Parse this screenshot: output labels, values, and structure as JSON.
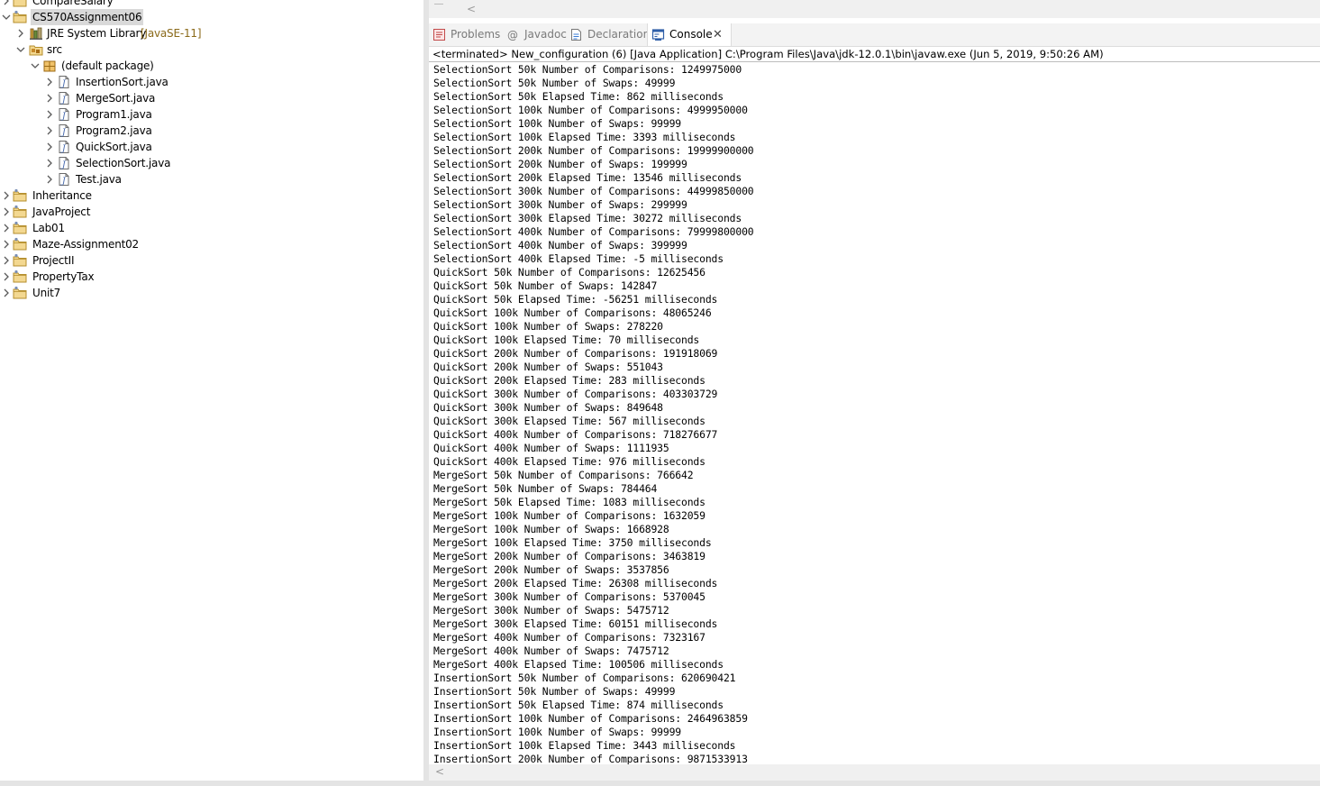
{
  "explorer": {
    "items": [
      {
        "label": "CompareSalary",
        "icon": "project-icon",
        "expanded": false,
        "depth": 0
      },
      {
        "label": "CS570Assignment06",
        "icon": "project-icon",
        "expanded": true,
        "depth": 0,
        "selected": true
      },
      {
        "label": "JRE System Library",
        "decoration": "[JavaSE-11]",
        "icon": "library-icon",
        "expanded": false,
        "depth": 1
      },
      {
        "label": "src",
        "icon": "source-folder-icon",
        "expanded": true,
        "depth": 1
      },
      {
        "label": "(default package)",
        "icon": "package-icon",
        "expanded": true,
        "depth": 2
      },
      {
        "label": "InsertionSort.java",
        "icon": "java-file-icon",
        "expanded": false,
        "depth": 3
      },
      {
        "label": "MergeSort.java",
        "icon": "java-file-icon",
        "expanded": false,
        "depth": 3
      },
      {
        "label": "Program1.java",
        "icon": "java-file-icon",
        "expanded": false,
        "depth": 3
      },
      {
        "label": "Program2.java",
        "icon": "java-file-icon",
        "expanded": false,
        "depth": 3
      },
      {
        "label": "QuickSort.java",
        "icon": "java-file-icon",
        "expanded": false,
        "depth": 3
      },
      {
        "label": "SelectionSort.java",
        "icon": "java-file-icon",
        "expanded": false,
        "depth": 3
      },
      {
        "label": "Test.java",
        "icon": "java-file-icon",
        "expanded": false,
        "depth": 3
      },
      {
        "label": "Inheritance",
        "icon": "project-icon",
        "expanded": false,
        "depth": 0
      },
      {
        "label": "JavaProject",
        "icon": "project-icon",
        "expanded": false,
        "depth": 0
      },
      {
        "label": "Lab01",
        "icon": "project-icon",
        "expanded": false,
        "depth": 0
      },
      {
        "label": "Maze-Assignment02",
        "icon": "project-icon",
        "expanded": false,
        "depth": 0
      },
      {
        "label": "ProjectII",
        "icon": "project-icon",
        "expanded": false,
        "depth": 0
      },
      {
        "label": "PropertyTax",
        "icon": "project-icon",
        "expanded": false,
        "depth": 0
      },
      {
        "label": "Unit7",
        "icon": "project-icon",
        "expanded": false,
        "depth": 0
      }
    ]
  },
  "tabs": [
    {
      "label": "Problems",
      "icon": "problems-icon",
      "active": false
    },
    {
      "label": "Javadoc",
      "icon": "javadoc-icon",
      "active": false
    },
    {
      "label": "Declaration",
      "icon": "declaration-icon",
      "active": false
    },
    {
      "label": "Console",
      "icon": "console-icon",
      "active": true,
      "close": "✕"
    }
  ],
  "console": {
    "header": "<terminated> New_configuration (6) [Java Application] C:\\Program Files\\Java\\jdk-12.0.1\\bin\\javaw.exe (Jun 5, 2019, 9:50:26 AM)",
    "lines": [
      "SelectionSort 50k Number of Comparisons: 1249975000",
      "SelectionSort 50k Number of Swaps: 49999",
      "SelectionSort 50k Elapsed Time: 862 milliseconds",
      "SelectionSort 100k Number of Comparisons: 4999950000",
      "SelectionSort 100k Number of Swaps: 99999",
      "SelectionSort 100k Elapsed Time: 3393 milliseconds",
      "SelectionSort 200k Number of Comparisons: 19999900000",
      "SelectionSort 200k Number of Swaps: 199999",
      "SelectionSort 200k Elapsed Time: 13546 milliseconds",
      "SelectionSort 300k Number of Comparisons: 44999850000",
      "SelectionSort 300k Number of Swaps: 299999",
      "SelectionSort 300k Elapsed Time: 30272 milliseconds",
      "SelectionSort 400k Number of Comparisons: 79999800000",
      "SelectionSort 400k Number of Swaps: 399999",
      "SelectionSort 400k Elapsed Time: -5 milliseconds",
      "QuickSort 50k Number of Comparisons: 12625456",
      "QuickSort 50k Number of Swaps: 142847",
      "QuickSort 50k Elapsed Time: -56251 milliseconds",
      "QuickSort 100k Number of Comparisons: 48065246",
      "QuickSort 100k Number of Swaps: 278220",
      "QuickSort 100k Elapsed Time: 70 milliseconds",
      "QuickSort 200k Number of Comparisons: 191918069",
      "QuickSort 200k Number of Swaps: 551043",
      "QuickSort 200k Elapsed Time: 283 milliseconds",
      "QuickSort 300k Number of Comparisons: 403303729",
      "QuickSort 300k Number of Swaps: 849648",
      "QuickSort 300k Elapsed Time: 567 milliseconds",
      "QuickSort 400k Number of Comparisons: 718276677",
      "QuickSort 400k Number of Swaps: 1111935",
      "QuickSort 400k Elapsed Time: 976 milliseconds",
      "MergeSort 50k Number of Comparisons: 766642",
      "MergeSort 50k Number of Swaps: 784464",
      "MergeSort 50k Elapsed Time: 1083 milliseconds",
      "MergeSort 100k Number of Comparisons: 1632059",
      "MergeSort 100k Number of Swaps: 1668928",
      "MergeSort 100k Elapsed Time: 3750 milliseconds",
      "MergeSort 200k Number of Comparisons: 3463819",
      "MergeSort 200k Number of Swaps: 3537856",
      "MergeSort 200k Elapsed Time: 26308 milliseconds",
      "MergeSort 300k Number of Comparisons: 5370045",
      "MergeSort 300k Number of Swaps: 5475712",
      "MergeSort 300k Elapsed Time: 60151 milliseconds",
      "MergeSort 400k Number of Comparisons: 7323167",
      "MergeSort 400k Number of Swaps: 7475712",
      "MergeSort 400k Elapsed Time: 100506 milliseconds",
      "InsertionSort 50k Number of Comparisons: 620690421",
      "InsertionSort 50k Number of Swaps: 49999",
      "InsertionSort 50k Elapsed Time: 874 milliseconds",
      "InsertionSort 100k Number of Comparisons: 2464963859",
      "InsertionSort 100k Number of Swaps: 99999",
      "InsertionSort 100k Elapsed Time: 3443 milliseconds",
      "InsertionSort 200k Number of Comparisons: 9871533913"
    ]
  },
  "scrollbars": {
    "left_arrow": "<"
  },
  "colors": {
    "selection": "#d9d9d9",
    "decoration": "#8b6a1a",
    "tab_bar": "#f3f3f3",
    "sash": "#e4e4e4"
  }
}
